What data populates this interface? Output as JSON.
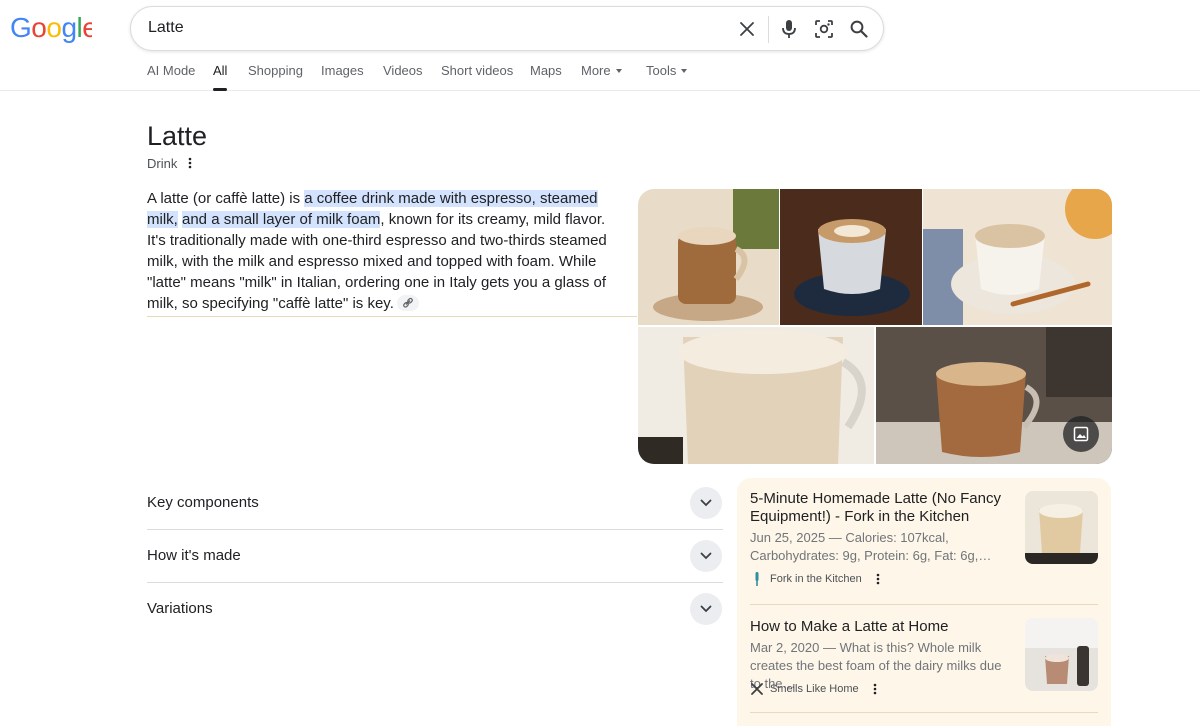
{
  "brand": {
    "logo_text": "Google",
    "colors": [
      "#4285F4",
      "#EA4335",
      "#FBBC05",
      "#4285F4",
      "#34A853",
      "#EA4335"
    ]
  },
  "search": {
    "query": "Latte",
    "icons": [
      "close-icon",
      "microphone-icon",
      "camera-lens-icon",
      "search-icon"
    ]
  },
  "tabs": [
    {
      "label": "AI Mode",
      "active": false
    },
    {
      "label": "All",
      "active": true
    },
    {
      "label": "Shopping",
      "active": false
    },
    {
      "label": "Images",
      "active": false
    },
    {
      "label": "Videos",
      "active": false
    },
    {
      "label": "Short videos",
      "active": false
    },
    {
      "label": "Maps",
      "active": false
    },
    {
      "label": "More",
      "active": false
    },
    {
      "label": "Tools",
      "active": false
    }
  ],
  "knowledge_panel": {
    "title": "Latte",
    "subtitle": "Drink",
    "description": {
      "pre": "A latte (or caffè latte) is ",
      "highlight_1": "a coffee drink made with espresso, steamed milk,",
      "highlight_2": "and a small layer of milk foam",
      "post": ", known for its creamy, mild flavor. It's traditionally made with one-third espresso and two-thirds steamed milk, with the milk and espresso mixed and topped with foam. While \"latte\" means \"milk\" in Italian, ordering one in Italy gets you a glass of milk, so specifying \"caffè latte\" is key."
    },
    "highlight_color": "#d3e3fd"
  },
  "accordions": [
    {
      "label": "Key components"
    },
    {
      "label": "How it's made"
    },
    {
      "label": "Variations"
    }
  ],
  "recipes": [
    {
      "title": "5-Minute Homemade Latte (No Fancy Equipment!) - Fork in the Kitchen",
      "snippet": "Jun 25, 2025 — Calories: 107kcal, Carbohydrates: 9g, Protein: 6g, Fat: 6g,…",
      "source": "Fork in the Kitchen",
      "favicon": "fork-icon"
    },
    {
      "title": "How to Make a Latte at Home",
      "snippet": "Mar 2, 2020 — What is this? Whole milk creates the best foam of the dairy milks due to the…",
      "source": "Smells Like Home",
      "favicon": "crossed-utensils-icon"
    }
  ],
  "colors": {
    "recipe_panel_bg": "#fef6e8",
    "text_primary": "#202124",
    "text_secondary": "#70757a"
  }
}
